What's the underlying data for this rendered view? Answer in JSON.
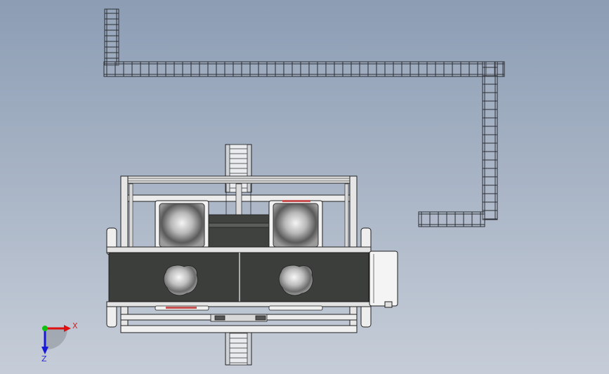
{
  "viewport": {
    "background_top": "#8c9db4",
    "background_bottom": "#c6cdd8"
  },
  "triad": {
    "x_label": "X",
    "z_label": "Z",
    "x_color": "#e01010",
    "y_color": "#10c010",
    "z_color": "#1818d8"
  },
  "model": {
    "frame_color": "#eeeeee",
    "belt_color": "#3b3e3a",
    "accent_color": "#c85050"
  }
}
